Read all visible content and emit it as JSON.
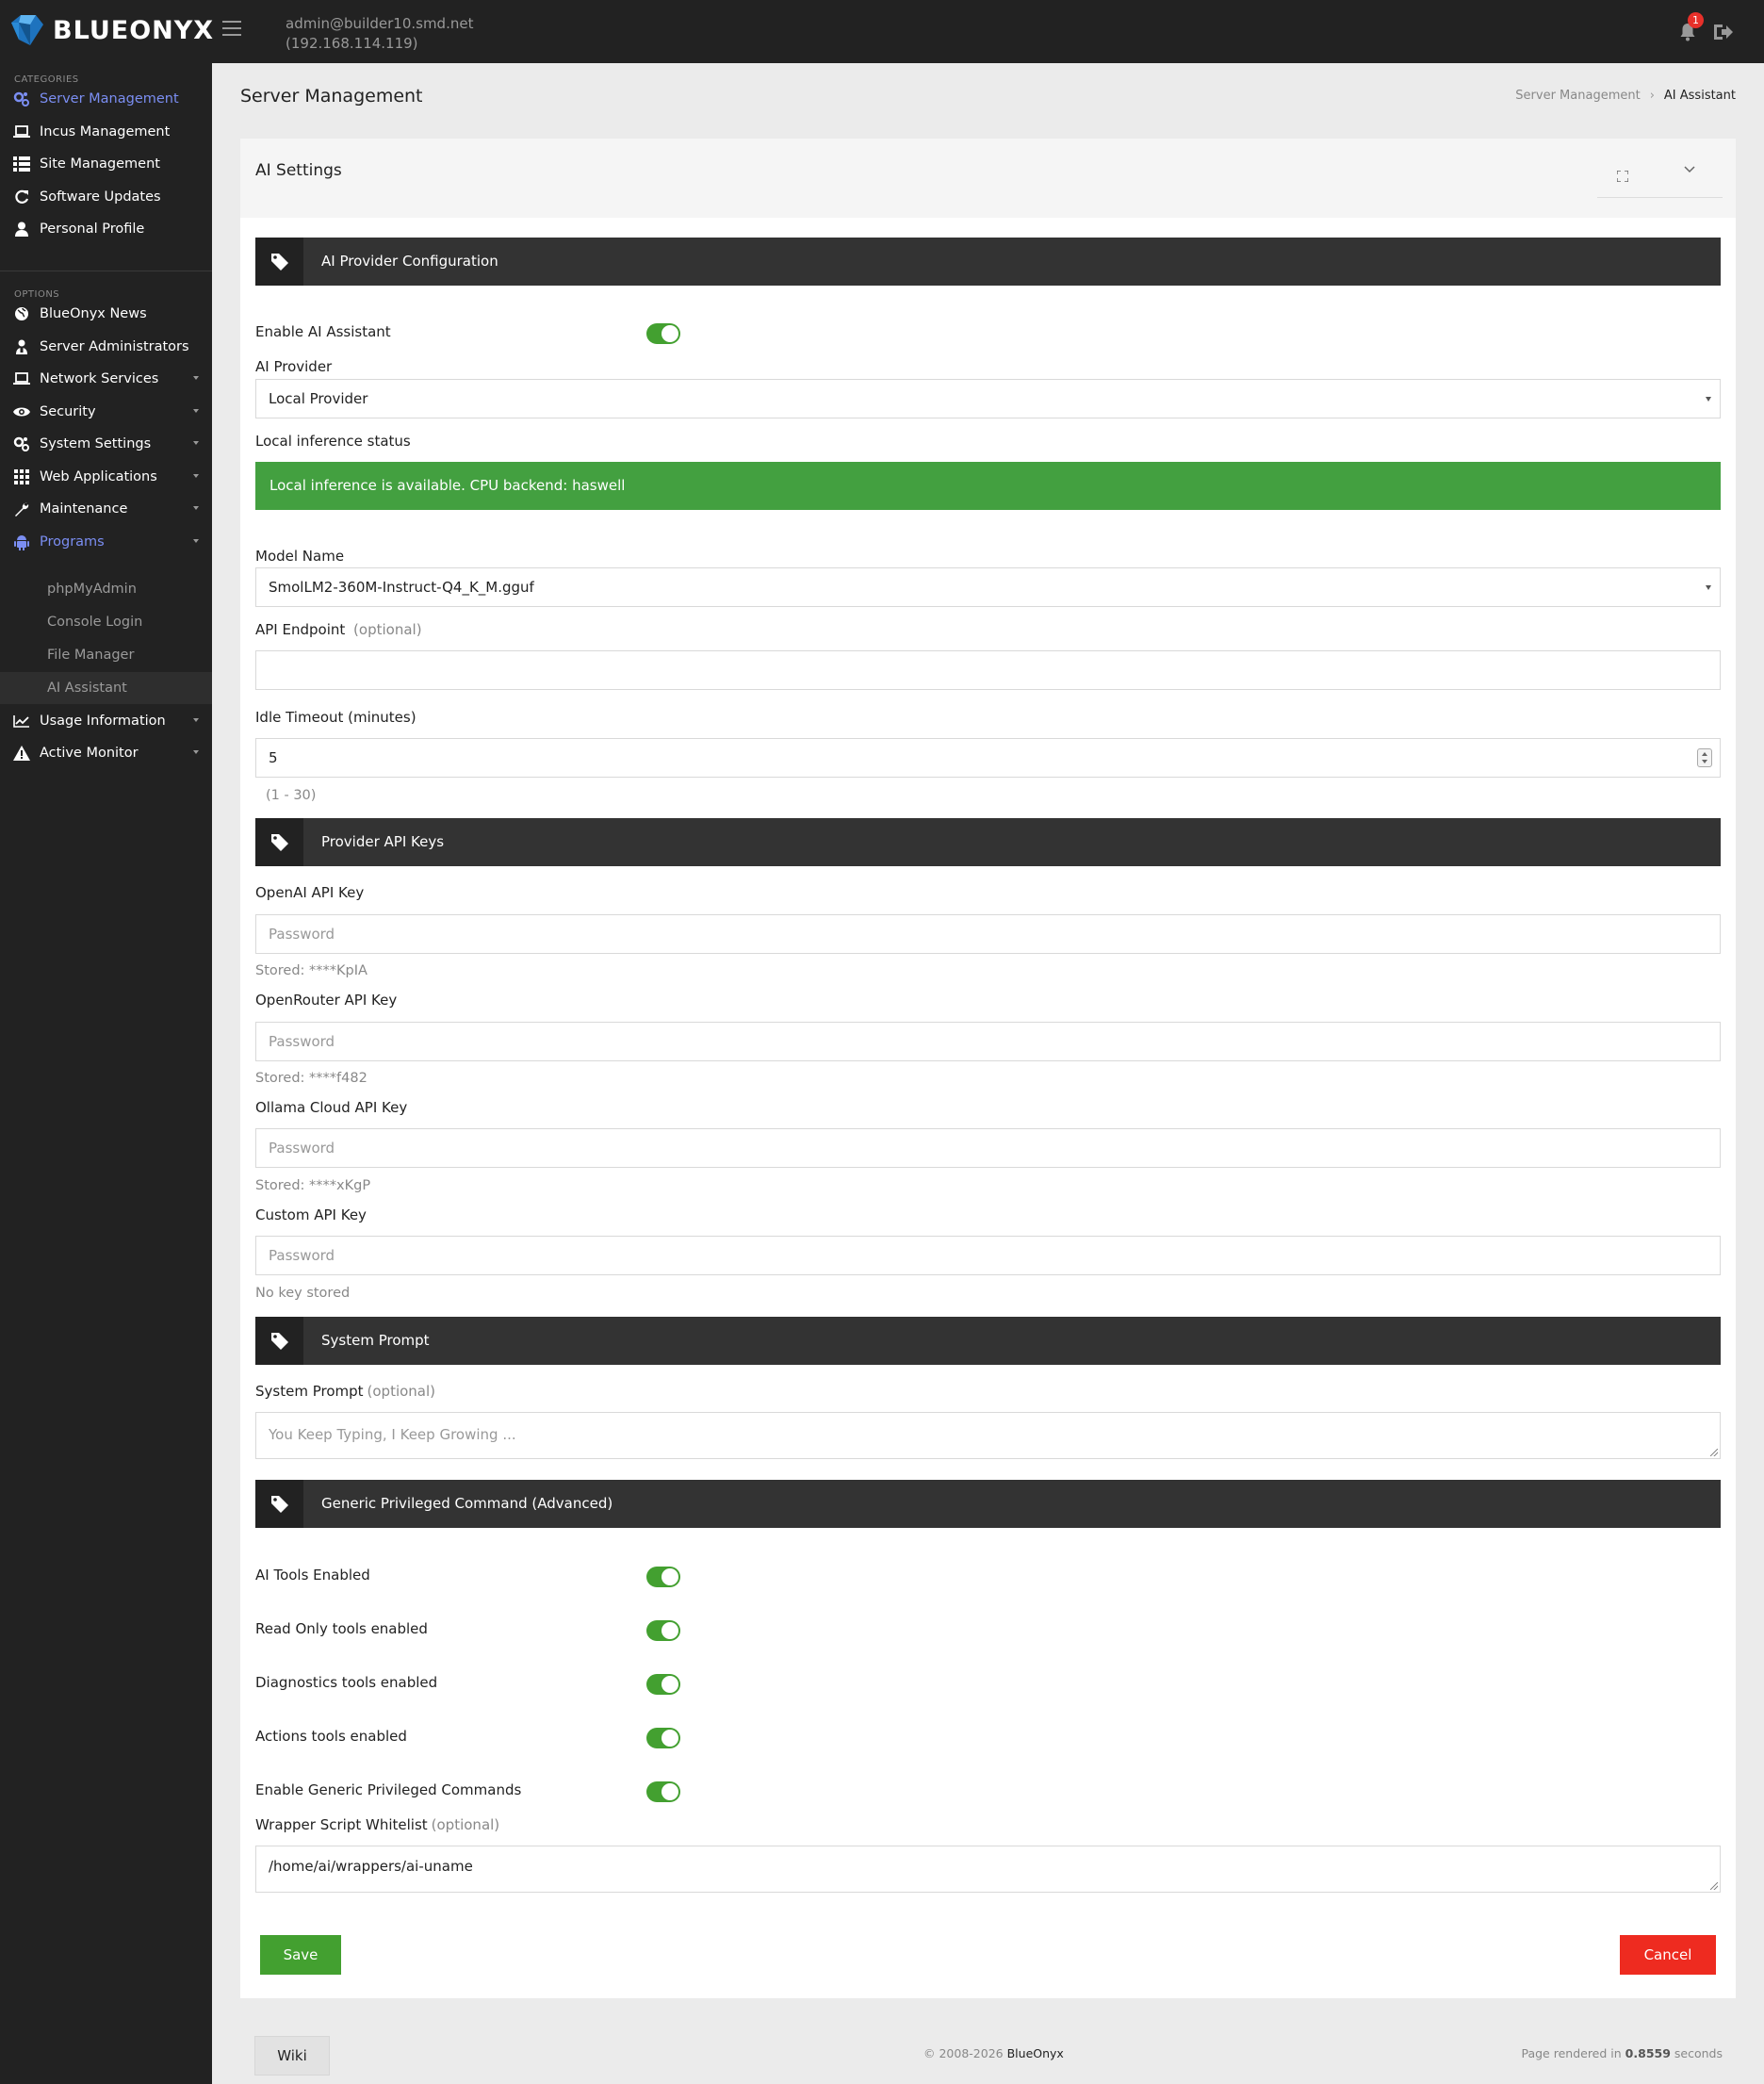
{
  "header": {
    "brand": "BLUEONYX",
    "user_email": "admin@builder10.smd.net",
    "user_ip": "(192.168.114.119)",
    "notification_count": "1"
  },
  "sidebar": {
    "categories_label": "CATEGORIES",
    "categories": [
      {
        "label": "Server Management",
        "icon": "gears-icon",
        "active": true
      },
      {
        "label": "Incus Management",
        "icon": "laptop-icon"
      },
      {
        "label": "Site Management",
        "icon": "list-icon"
      },
      {
        "label": "Software Updates",
        "icon": "refresh-icon"
      },
      {
        "label": "Personal Profile",
        "icon": "user-icon"
      }
    ],
    "options_label": "OPTIONS",
    "options": [
      {
        "label": "BlueOnyx News",
        "icon": "globe-icon"
      },
      {
        "label": "Server Administrators",
        "icon": "users-icon"
      },
      {
        "label": "Network Services",
        "icon": "laptop-icon"
      },
      {
        "label": "Security",
        "icon": "eye-icon"
      },
      {
        "label": "System Settings",
        "icon": "gears-icon"
      },
      {
        "label": "Web Applications",
        "icon": "grid-icon"
      },
      {
        "label": "Maintenance",
        "icon": "wrench-icon"
      },
      {
        "label": "Programs",
        "icon": "android-icon"
      },
      {
        "label": "Usage Information",
        "icon": "chart-icon"
      },
      {
        "label": "Active Monitor",
        "icon": "warning-icon"
      }
    ],
    "programs_sub": [
      "phpMyAdmin",
      "Console Login",
      "File Manager",
      "AI Assistant"
    ]
  },
  "page": {
    "title": "Server Management",
    "breadcrumb": [
      "Server Management",
      "AI Assistant"
    ]
  },
  "panel": {
    "title": "AI Settings",
    "sections": {
      "provider": "AI Provider Configuration",
      "keys": "Provider API Keys",
      "prompt": "System Prompt",
      "generic": "Generic Privileged Command (Advanced)"
    },
    "enable_ai_label": "Enable AI Assistant",
    "enable_ai_on": true,
    "provider_label": "AI Provider",
    "provider_value": "Local Provider",
    "status_label": "Local inference status",
    "status_message": "Local inference is available. CPU backend: haswell",
    "model_label": "Model Name",
    "model_value": "SmolLM2-360M-Instruct-Q4_K_M.gguf",
    "endpoint_label": "API Endpoint",
    "optional_text": "(optional)",
    "endpoint_value": "",
    "idle_label": "Idle Timeout (minutes)",
    "idle_value": "5",
    "idle_range": "(1 - 30)",
    "password_placeholder": "Password",
    "openai_label": "OpenAI API Key",
    "openai_stored": "Stored: ****KpIA",
    "openrouter_label": "OpenRouter API Key",
    "openrouter_stored": "Stored: ****f482",
    "ollama_label": "Ollama Cloud API Key",
    "ollama_stored": "Stored: ****xKgP",
    "custom_label": "Custom API Key",
    "custom_stored": "No key stored",
    "system_prompt_label": "System Prompt",
    "system_prompt_placeholder": "You Keep Typing, I Keep Growing ...",
    "tools_enabled_label": "AI Tools Enabled",
    "readonly_label": "Read Only tools enabled",
    "diagnostics_label": "Diagnostics tools enabled",
    "actions_label": "Actions tools enabled",
    "generic_label": "Enable Generic Privileged Commands",
    "whitelist_label": "Wrapper Script Whitelist",
    "whitelist_value": "/home/ai/wrappers/ai-uname",
    "save_label": "Save",
    "cancel_label": "Cancel"
  },
  "footer": {
    "wiki_label": "Wiki",
    "copyright_prefix": "© 2008-2026",
    "copyright_brand": "BlueOnyx",
    "render_prefix": "Page rendered in",
    "render_time": "0.8559",
    "render_suffix": "seconds"
  },
  "colors": {
    "accent": "#7b8ef2",
    "toggle_on": "#43a030",
    "success": "#43a040",
    "danger": "#ee2b20",
    "sidebar_bg": "#222222",
    "section_bg": "#333333"
  }
}
